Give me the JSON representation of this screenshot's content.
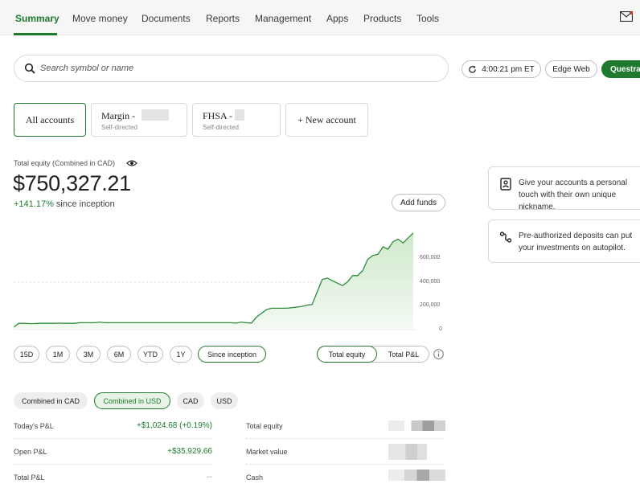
{
  "nav": {
    "items": [
      "Summary",
      "Move money",
      "Documents",
      "Reports",
      "Management",
      "Apps",
      "Products",
      "Tools"
    ]
  },
  "search": {
    "placeholder": "Search symbol or name"
  },
  "header": {
    "time": "4:00:21 pm ET",
    "edge": "Edge Web",
    "questrade": "Questrade"
  },
  "accounts": {
    "all": "All accounts",
    "margin": {
      "name": "Margin -",
      "type": "Self-directed"
    },
    "fhsa": {
      "name": "FHSA -",
      "type": "Self-directed"
    },
    "new": "+ New account"
  },
  "equity": {
    "label": "Total equity (Combined in CAD)",
    "value": "$750,327.21",
    "change": "+141.17%",
    "change_suffix": "since inception",
    "add_funds": "Add funds"
  },
  "chart_data": {
    "type": "area",
    "y_ticks": [
      "600,000",
      "400,000",
      "200,000",
      "0"
    ],
    "ylim": [
      0,
      800000
    ],
    "values": [
      20000,
      50000,
      50000,
      48000,
      48000,
      50000,
      50000,
      50000,
      50000,
      52000,
      50000,
      50000,
      50000,
      55000,
      55000,
      55000,
      55000,
      60000,
      55000,
      55000,
      55000,
      55000,
      55000,
      55000,
      55000,
      55000,
      55000,
      55000,
      55000,
      55000,
      55000,
      55000,
      55000,
      55000,
      55000,
      55000,
      55000,
      55000,
      55000,
      55000,
      55000,
      55000,
      55000,
      55000,
      52000,
      60000,
      55000,
      52000,
      100000,
      130000,
      160000,
      170000,
      170000,
      170000,
      170000,
      175000,
      180000,
      185000,
      195000,
      200000,
      300000,
      400000,
      410000,
      390000,
      370000,
      350000,
      380000,
      430000,
      430000,
      470000,
      560000,
      590000,
      600000,
      660000,
      640000,
      700000,
      720000,
      690000,
      730000,
      770000
    ]
  },
  "ranges": [
    "15D",
    "1M",
    "3M",
    "6M",
    "YTD",
    "1Y",
    "Since inception"
  ],
  "view_toggle": {
    "a": "Total equity",
    "b": "Total P&L"
  },
  "currencies": [
    "Combined in CAD",
    "Combined in USD",
    "CAD",
    "USD"
  ],
  "stats": {
    "todays_pl_label": "Today's P&L",
    "todays_pl_value": "+$1,024.68 (+0.19%)",
    "open_pl_label": "Open P&L",
    "open_pl_value": "+$35,929.66",
    "total_pl_label": "Total P&L",
    "total_pl_value": "--",
    "total_equity_label": "Total equity",
    "market_value_label": "Market value",
    "cash_label": "Cash"
  },
  "tips": {
    "tip1": "Give your accounts a personal touch with their own unique nickname.",
    "tip2": "Pre-authorized deposits can put your investments on autopilot."
  },
  "colors": {
    "accent": "#1f7a2e",
    "chart_fill": "#dff0dd"
  }
}
